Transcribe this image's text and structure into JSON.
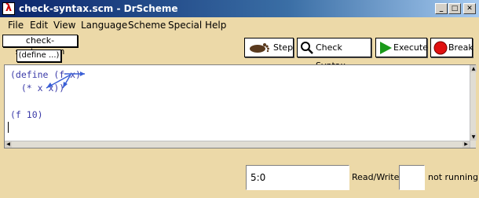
{
  "window": {
    "title": "check-syntax.scm - DrScheme",
    "app_icon": "λ",
    "controls": {
      "minimize": "_",
      "maximize": "□",
      "close": "✕"
    }
  },
  "menu": [
    "File",
    "Edit",
    "View",
    "Language",
    "Scheme",
    "Special",
    "Help"
  ],
  "toolbar": {
    "file_label": "check-syntax.scm",
    "define_label": "(define ...)",
    "step_label": "Step",
    "check_syntax_label": "Check Syntax",
    "execute_label": "Execute",
    "break_label": "Break"
  },
  "editor": {
    "lines": [
      "(define (f x)",
      "  (* x x))",
      "",
      "(f 10)"
    ],
    "arrow_color": "#3a5fd6"
  },
  "status": {
    "position": "5:0",
    "mode": "Read/Write",
    "state": "not running"
  },
  "colors": {
    "panel": "#ecd9a8",
    "code": "#3a3aa8",
    "execute_green": "#1a9a1a",
    "break_red": "#e01010"
  }
}
